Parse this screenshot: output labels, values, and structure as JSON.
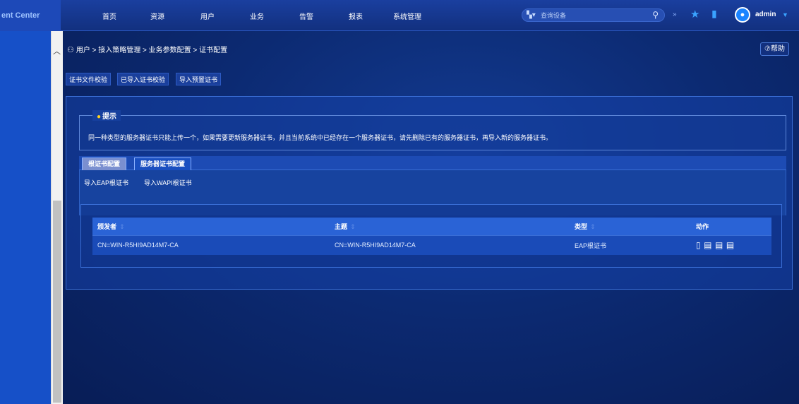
{
  "brand": {
    "text": "ent Center"
  },
  "nav": [
    "首页",
    "资源",
    "用户",
    "业务",
    "告警",
    "报表",
    "系统管理"
  ],
  "search": {
    "placeholder": "查询设备",
    "device_icon": "device-type-icon",
    "search_icon": "search-icon"
  },
  "header_icons": [
    "double-chevron-icon",
    "star-icon",
    "bookmark-icon",
    "user-avatar-icon"
  ],
  "user": {
    "name": "admin"
  },
  "breadcrumb": {
    "text": "用户 > 接入策略管理 > 业务参数配置 > 证书配置"
  },
  "help": {
    "label": "⑦帮助"
  },
  "toolbar": {
    "btn1": "证书文件校验",
    "btn2": "已导入证书校验",
    "btn3": "导入预置证书"
  },
  "tip": {
    "legend": "提示",
    "text": "同一种类型的服务器证书只能上传一个，如果需要更新服务器证书，并且当前系统中已经存在一个服务器证书，请先删除已有的服务器证书，再导入新的服务器证书。"
  },
  "tabs": [
    {
      "label": "根证书配置",
      "active": true
    },
    {
      "label": "服务器证书配置",
      "active": false
    }
  ],
  "sub_buttons": [
    "导入EAP根证书",
    "导入WAPI根证书"
  ],
  "table": {
    "headers": [
      "颁发者",
      "主题",
      "类型",
      "动作"
    ],
    "rows": [
      {
        "issuer": "CN=WIN-R5HI9AD14M7-CA",
        "subject": "CN=WIN-R5HI9AD14M7-CA",
        "type": "EAP根证书"
      }
    ]
  },
  "colors": {
    "accent": "#3aa3ff",
    "header_bg": "#12307f",
    "table_header": "#2a63d6"
  }
}
